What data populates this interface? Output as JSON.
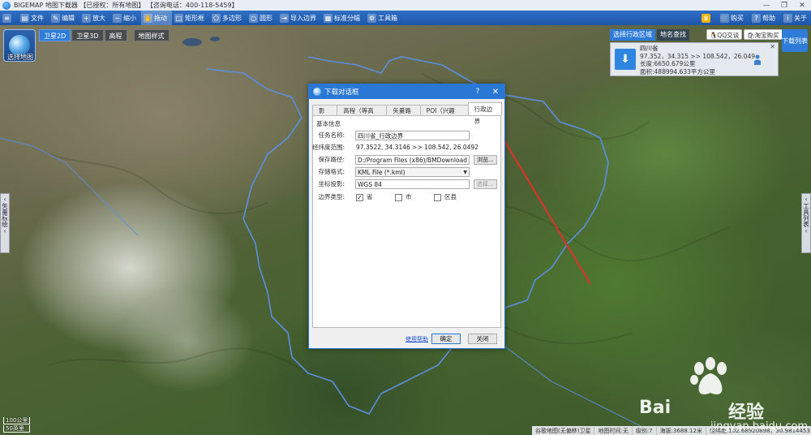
{
  "window": {
    "title": "BIGEMAP 地图下载器 【已授权：所有地图】 【咨询电话：400-118-5459】"
  },
  "toolbar": {
    "items": [
      {
        "label": "",
        "icon": "menu-icon"
      },
      {
        "label": "文件",
        "icon": "folder-icon"
      },
      {
        "label": "编辑",
        "icon": "edit-icon"
      },
      {
        "label": "放大",
        "icon": "zoom-in-icon"
      },
      {
        "label": "缩小",
        "icon": "zoom-out-icon"
      },
      {
        "label": "拖动",
        "icon": "hand-icon"
      },
      {
        "label": "矩形框",
        "icon": "rectangle-icon"
      },
      {
        "label": "多边形",
        "icon": "polygon-icon"
      },
      {
        "label": "圆形",
        "icon": "circle-icon"
      },
      {
        "label": "导入边界",
        "icon": "import-icon"
      },
      {
        "label": "标准分幅",
        "icon": "grid-icon"
      },
      {
        "label": "工具箱",
        "icon": "toolbox-icon"
      }
    ],
    "right_items": [
      {
        "label": "",
        "icon": "vip-icon"
      },
      {
        "label": "购买",
        "icon": "cart-icon"
      },
      {
        "label": "帮助",
        "icon": "help-icon"
      },
      {
        "label": "关于",
        "icon": "info-icon"
      }
    ]
  },
  "map_panel": {
    "select_map_label": "选择地图",
    "tabs": [
      "卫星2D",
      "卫星3D",
      "高程",
      "地图样式"
    ],
    "selected_tab": "卫星2D",
    "search_tabs": [
      "选择行政区域",
      "地名查找"
    ],
    "qq_label": "QQ交谈",
    "buy_label": "淘宝购买",
    "download_list_label": "下载列表",
    "result": {
      "name": "四川省",
      "coords": "97.352，34.315 >> 108.542，26.049",
      "perimeter": "长度:6650.679公里",
      "area": "面积:488994.633平方公里"
    },
    "left_handle": "矢量标绘",
    "right_handle": "工具列表"
  },
  "status": {
    "scale_1": "100公里",
    "scale_2": "50英里",
    "items": [
      "谷歌地图(无偏移)卫星",
      "地图时间:无",
      "级别:7",
      "海拔:3688.12米",
      "经纬度:102.68920898，30.98144531"
    ]
  },
  "dialog": {
    "title": "下载对话框",
    "help_symbol": "?",
    "close_symbol": "✕",
    "tabs": [
      "影 像",
      "高程（等高线）",
      "矢量路网",
      "POI（兴趣点）",
      "行政边界"
    ],
    "selected_tab": "行政边界",
    "section_title": "基本信息",
    "fields": {
      "task_name_label": "任务名称:",
      "task_name_value": "四川省_行政边界",
      "range_label": "经纬度范围:",
      "range_value": "97.3522, 34.3146   >>   108.542, 26.0492",
      "save_path_label": "保存路径:",
      "save_path_value": "D:/Program Files (x86)/BMDownload",
      "browse_label": "浏览...",
      "format_label": "存储格式:",
      "format_value": "KML File (*.kml)",
      "coord_label": "坐标投影:",
      "coord_value": "WGS 84",
      "coord_btn": "选择...",
      "boundary_label": "边界类型:",
      "boundary_options": [
        {
          "label": "省",
          "checked": true
        },
        {
          "label": "市",
          "checked": false
        },
        {
          "label": "区县",
          "checked": false
        }
      ]
    },
    "help_link": "使用帮助",
    "ok_label": "确定",
    "close_label": "关闭"
  },
  "watermark": {
    "brand_left": "Bai",
    "brand_right": "经验",
    "url": "jingyan.baidu.com"
  },
  "colors": {
    "accent": "#2a78d6",
    "arrow": "#e0302a",
    "boundary": "#5b8fe0"
  }
}
